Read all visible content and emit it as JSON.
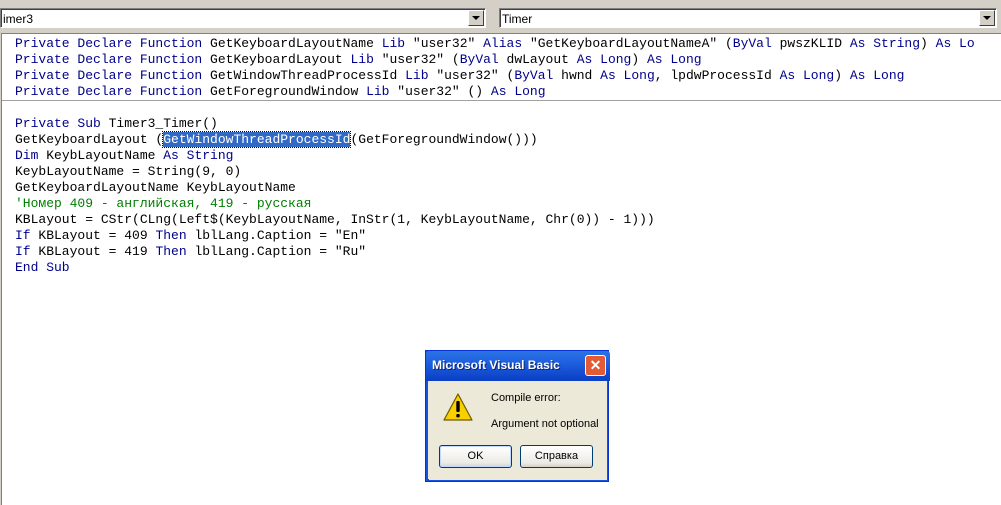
{
  "combos": {
    "object": "imer3",
    "procedure": "Timer"
  },
  "declarations": [
    {
      "parts": [
        [
          "kw",
          "Private Declare Function "
        ],
        [
          "t",
          "GetKeyboardLayoutName "
        ],
        [
          "kw",
          "Lib "
        ],
        [
          "t",
          "\"user32\" "
        ],
        [
          "kw",
          "Alias "
        ],
        [
          "t",
          "\"GetKeyboardLayoutNameA\" ("
        ],
        [
          "kw",
          "ByVal "
        ],
        [
          "t",
          "pwszKLID "
        ],
        [
          "kw",
          "As String"
        ],
        [
          "t",
          ") "
        ],
        [
          "kw",
          "As Lo"
        ]
      ]
    },
    {
      "parts": [
        [
          "kw",
          "Private Declare Function "
        ],
        [
          "t",
          "GetKeyboardLayout "
        ],
        [
          "kw",
          "Lib "
        ],
        [
          "t",
          "\"user32\" ("
        ],
        [
          "kw",
          "ByVal "
        ],
        [
          "t",
          "dwLayout "
        ],
        [
          "kw",
          "As Long"
        ],
        [
          "t",
          ") "
        ],
        [
          "kw",
          "As Long"
        ]
      ]
    },
    {
      "parts": [
        [
          "kw",
          "Private Declare Function "
        ],
        [
          "t",
          "GetWindowThreadProcessId "
        ],
        [
          "kw",
          "Lib "
        ],
        [
          "t",
          "\"user32\" ("
        ],
        [
          "kw",
          "ByVal "
        ],
        [
          "t",
          "hwnd "
        ],
        [
          "kw",
          "As Long"
        ],
        [
          "t",
          ", lpdwProcessId "
        ],
        [
          "kw",
          "As Long"
        ],
        [
          "t",
          ") "
        ],
        [
          "kw",
          "As Long"
        ]
      ]
    },
    {
      "parts": [
        [
          "kw",
          "Private Declare Function "
        ],
        [
          "t",
          "GetForegroundWindow "
        ],
        [
          "kw",
          "Lib "
        ],
        [
          "t",
          "\"user32\" () "
        ],
        [
          "kw",
          "As Long"
        ]
      ]
    }
  ],
  "body": [
    {
      "parts": [
        [
          "kw",
          "Private Sub "
        ],
        [
          "t",
          "Timer3_Timer()"
        ]
      ]
    },
    {
      "parts": [
        [
          "t",
          "GetKeyboardLayout ("
        ],
        [
          "sel",
          "GetWindowThreadProcessId"
        ],
        [
          "t",
          "(GetForegroundWindow()))"
        ]
      ]
    },
    {
      "parts": [
        [
          "kw",
          "Dim "
        ],
        [
          "t",
          "KeybLayoutName "
        ],
        [
          "kw",
          "As String"
        ]
      ]
    },
    {
      "parts": [
        [
          "t",
          "KeybLayoutName = String(9, 0)"
        ]
      ]
    },
    {
      "parts": [
        [
          "t",
          "GetKeyboardLayoutName KeybLayoutName"
        ]
      ]
    },
    {
      "parts": [
        [
          "cm",
          "'Номер 409 - английская, 419 - русская"
        ]
      ]
    },
    {
      "parts": [
        [
          "t",
          "KBLayout = CStr(CLng(Left$(KeybLayoutName, InStr(1, KeybLayoutName, Chr(0)) - 1)))"
        ]
      ]
    },
    {
      "parts": [
        [
          "kw",
          "If "
        ],
        [
          "t",
          "KBLayout = 409 "
        ],
        [
          "kw",
          "Then "
        ],
        [
          "t",
          "lblLang.Caption = \"En\""
        ]
      ]
    },
    {
      "parts": [
        [
          "kw",
          "If "
        ],
        [
          "t",
          "KBLayout = 419 "
        ],
        [
          "kw",
          "Then "
        ],
        [
          "t",
          "lblLang.Caption = \"Ru\""
        ]
      ]
    },
    {
      "parts": [
        [
          "kw",
          "End Sub"
        ]
      ]
    }
  ],
  "dialog": {
    "title": "Microsoft Visual Basic",
    "close": "✕",
    "message_title": "Compile error:",
    "message": "Argument not optional",
    "ok_label": "OK",
    "help_label": "Справка"
  }
}
